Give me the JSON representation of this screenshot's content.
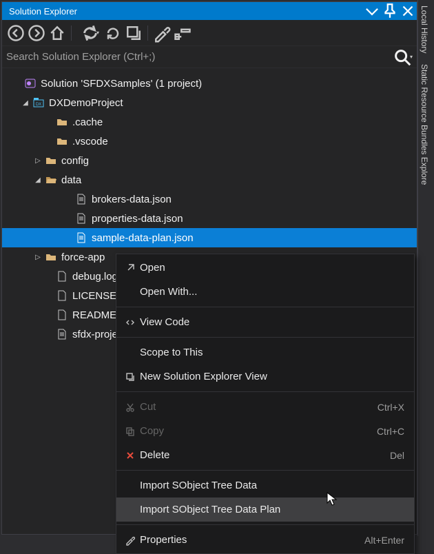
{
  "panel": {
    "title": "Solution Explorer"
  },
  "search": {
    "placeholder": "Search Solution Explorer (Ctrl+;)"
  },
  "vertical_tabs": [
    "Local History",
    "Static Resource Bundles Explore"
  ],
  "tree": {
    "root": {
      "label": "Solution 'SFDXSamples' (1 project)"
    },
    "project": {
      "label": "DXDemoProject"
    },
    "folders": {
      "cache": ".cache",
      "vscode": ".vscode",
      "config": "config",
      "data": "data",
      "forceapp": "force-app"
    },
    "data_files": {
      "brokers": "brokers-data.json",
      "properties": "properties-data.json",
      "sampleplan": "sample-data-plan.json"
    },
    "files": {
      "debug": "debug.log",
      "license": "LICENSE",
      "readme": "README.md",
      "sfdx": "sfdx-project.json"
    }
  },
  "contextmenu": {
    "open": "Open",
    "openwith": "Open With...",
    "viewcode": "View Code",
    "scope": "Scope to This",
    "newview": "New Solution Explorer View",
    "cut": "Cut",
    "cut_sc": "Ctrl+X",
    "copy": "Copy",
    "copy_sc": "Ctrl+C",
    "delete": "Delete",
    "delete_sc": "Del",
    "import_tree": "Import SObject Tree Data",
    "import_plan": "Import SObject Tree Data Plan",
    "properties": "Properties",
    "properties_sc": "Alt+Enter"
  }
}
